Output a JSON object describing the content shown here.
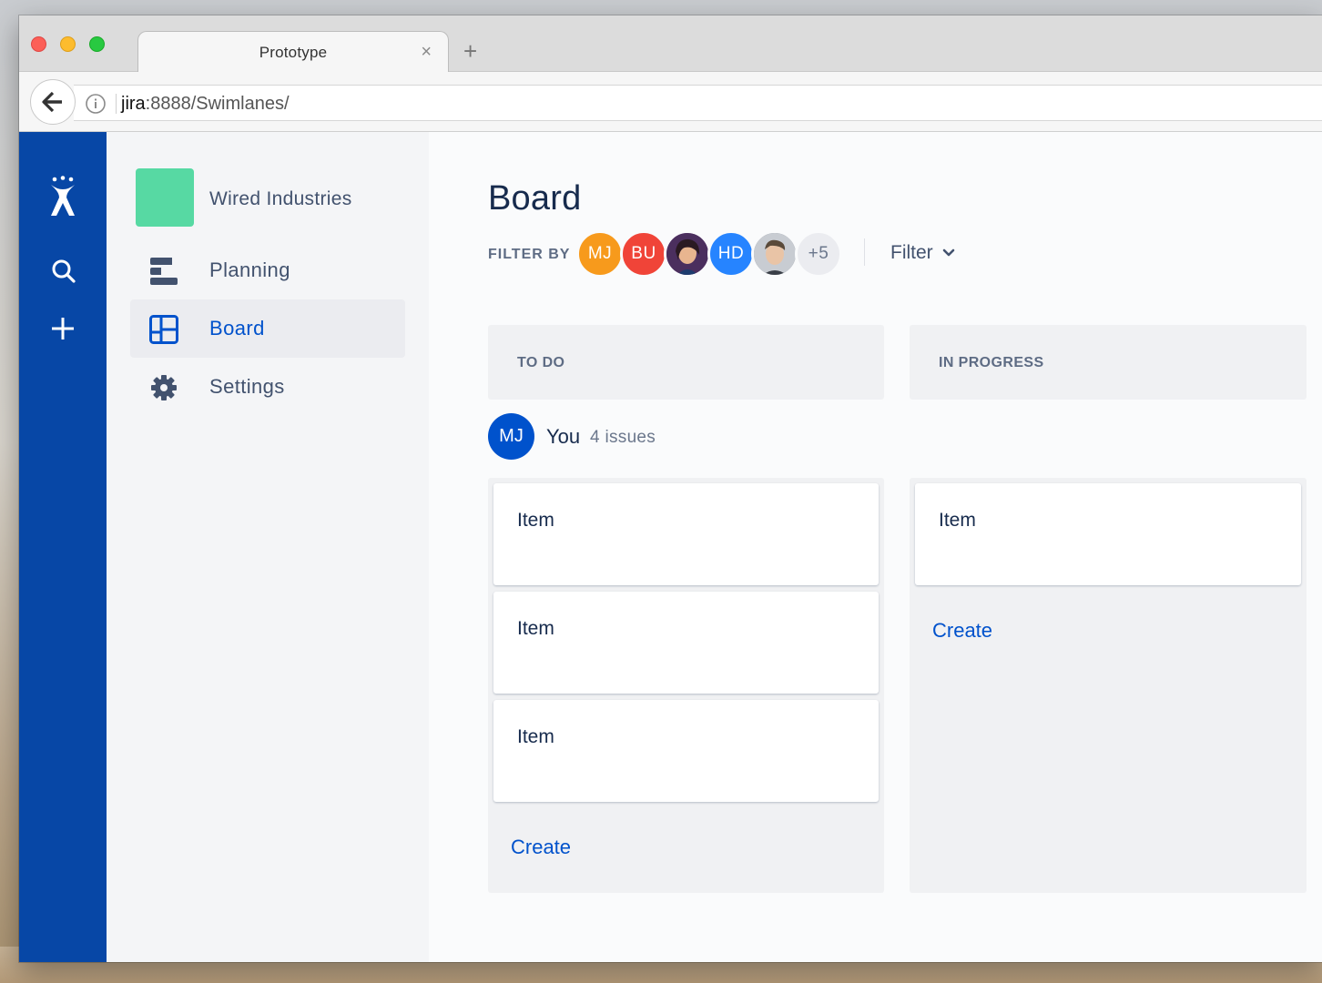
{
  "browser": {
    "tab_title": "Prototype",
    "tab_close": "×",
    "new_tab": "+",
    "url_host": "jira",
    "url_path": ":8888/Swimlanes/"
  },
  "global_nav": {
    "icons": [
      "jira-logo-icon",
      "search-icon",
      "create-plus-icon"
    ]
  },
  "project_nav": {
    "project_name": "Wired Industries",
    "project_avatar_color": "#57d9a3",
    "items": [
      {
        "label": "Planning",
        "icon": "backlog-icon",
        "selected": false
      },
      {
        "label": "Board",
        "icon": "board-icon",
        "selected": true
      },
      {
        "label": "Settings",
        "icon": "gear-icon",
        "selected": false
      }
    ]
  },
  "main": {
    "title": "Board",
    "filter_by_label": "FILTER BY",
    "avatars": [
      {
        "initials": "MJ",
        "color": "#f79a1c"
      },
      {
        "initials": "BU",
        "color": "#f04438"
      },
      {
        "initials": "",
        "color": "#7a4a8c",
        "photo": true
      },
      {
        "initials": "HD",
        "color": "#2684ff"
      },
      {
        "initials": "",
        "color": "#8a9099",
        "photo": true
      },
      {
        "initials": "+5",
        "color": "#ebecf0"
      }
    ],
    "filter_dropdown_label": "Filter",
    "columns": [
      {
        "title": "TO DO"
      },
      {
        "title": "IN PROGRESS"
      }
    ],
    "swimlane": {
      "initials": "MJ",
      "name": "You",
      "count_label": "4 issues"
    },
    "todo_cards": [
      "Item",
      "Item",
      "Item"
    ],
    "inprogress_cards": [
      "Item"
    ],
    "create_label": "Create"
  },
  "colors": {
    "global_nav_bg": "#0747a6",
    "accent": "#0052cc",
    "text_primary": "#172b4d",
    "text_secondary": "#42526e"
  }
}
